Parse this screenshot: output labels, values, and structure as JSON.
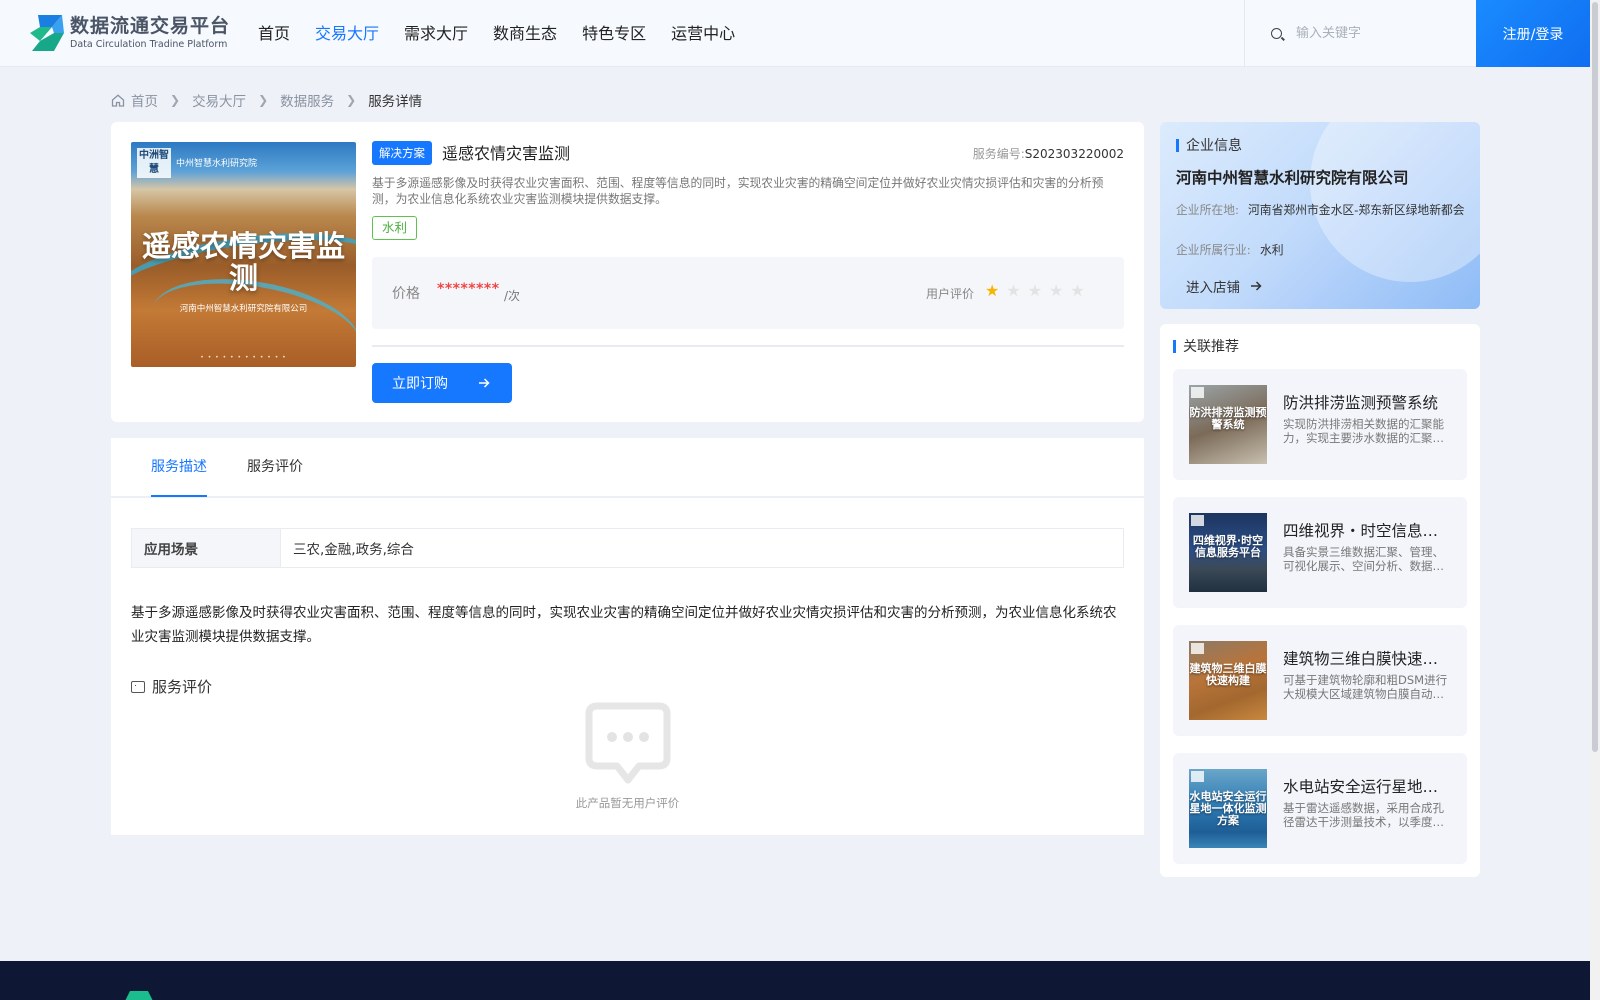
{
  "header": {
    "logo_cn": "数据流通交易平台",
    "logo_en": "Data Circulation Tradine Platform",
    "nav": [
      {
        "label": "首页",
        "active": false
      },
      {
        "label": "交易大厅",
        "active": true
      },
      {
        "label": "需求大厅",
        "active": false
      },
      {
        "label": "数商生态",
        "active": false
      },
      {
        "label": "特色专区",
        "active": false
      },
      {
        "label": "运营中心",
        "active": false
      }
    ],
    "search_placeholder": "输入关键字",
    "search_value": "",
    "login_label": "注册/登录",
    "accent": "#1677ff"
  },
  "breadcrumb": {
    "items": [
      "首页",
      "交易大厅",
      "数据服务"
    ],
    "current": "服务详情"
  },
  "product": {
    "cover": {
      "badge": "中洲智慧",
      "org": "中州智慧水利研究院",
      "title": "遥感农情灾害监测",
      "subtitle": "河南中州智慧水利研究院有限公司"
    },
    "type_tag": "解决方案",
    "title": "遥感农情灾害监测",
    "service_no_label": "服务编号:",
    "service_no": "S202303220002",
    "desc": "基于多源遥感影像及时获得农业灾害面积、范围、程度等信息的同时，实现农业灾害的精确空间定位并做好农业灾情灾损评估和灾害的分析预测，为农业信息化系统农业灾害监测模块提供数据支撑。",
    "industry_tag": "水利",
    "price_label": "价格",
    "price_value": "********",
    "price_unit": "/次",
    "rating_label": "用户评价",
    "rating": 1,
    "rating_max": 5,
    "buy_label": "立即订购"
  },
  "tabs": {
    "items": [
      {
        "label": "服务描述",
        "active": true
      },
      {
        "label": "服务评价",
        "active": false
      }
    ],
    "scene_key": "应用场景",
    "scene_value": "三农,金融,政务,综合",
    "description": "基于多源遥感影像及时获得农业灾害面积、范围、程度等信息的同时，实现农业灾害的精确空间定位并做好农业灾情灾损评估和灾害的分析预测，为农业信息化系统农业灾害监测模块提供数据支撑。",
    "review_title": "服务评价",
    "empty_text": "此产品暂无用户评价"
  },
  "company": {
    "section_title": "企业信息",
    "name": "河南中州智慧水利研究院有限公司",
    "location_key": "企业所在地:",
    "location_value": "河南省郑州市金水区-郑东新区绿地新都会",
    "industry_key": "企业所属行业:",
    "industry_value": "水利",
    "enter_label": "进入店铺"
  },
  "recommend": {
    "section_title": "关联推荐",
    "items": [
      {
        "title": "防洪排涝监测预警系统",
        "desc": "实现防洪排涝相关数据的汇聚能力，实现主要涉水数据的汇聚、管理与应用。",
        "thumb": "防洪排涝监测预警系统",
        "color": "#7a8a90"
      },
      {
        "title": "四维视界・时空信息服务平台",
        "desc": "具备实景三维数据汇聚、管理、可视化展示、空间分析、数据共享等功能。",
        "thumb": "四维视界·时空信息服务平台",
        "color": "#2a4a7a"
      },
      {
        "title": "建筑物三维白膜快速构建",
        "desc": "可基于建筑物轮廓和粗DSM进行大规模大区域建筑物白膜自动化构建。",
        "thumb": "建筑物三维白膜快速构建",
        "color": "#b86a2c"
      },
      {
        "title": "水电站安全运行星地一体化监测方案",
        "desc": "基于雷达遥感数据，采用合成孔径雷达干涉测量技术，以季度频次监测。",
        "thumb": "水电站安全运行星地一体化监测方案",
        "color": "#3a7fb0"
      }
    ]
  }
}
